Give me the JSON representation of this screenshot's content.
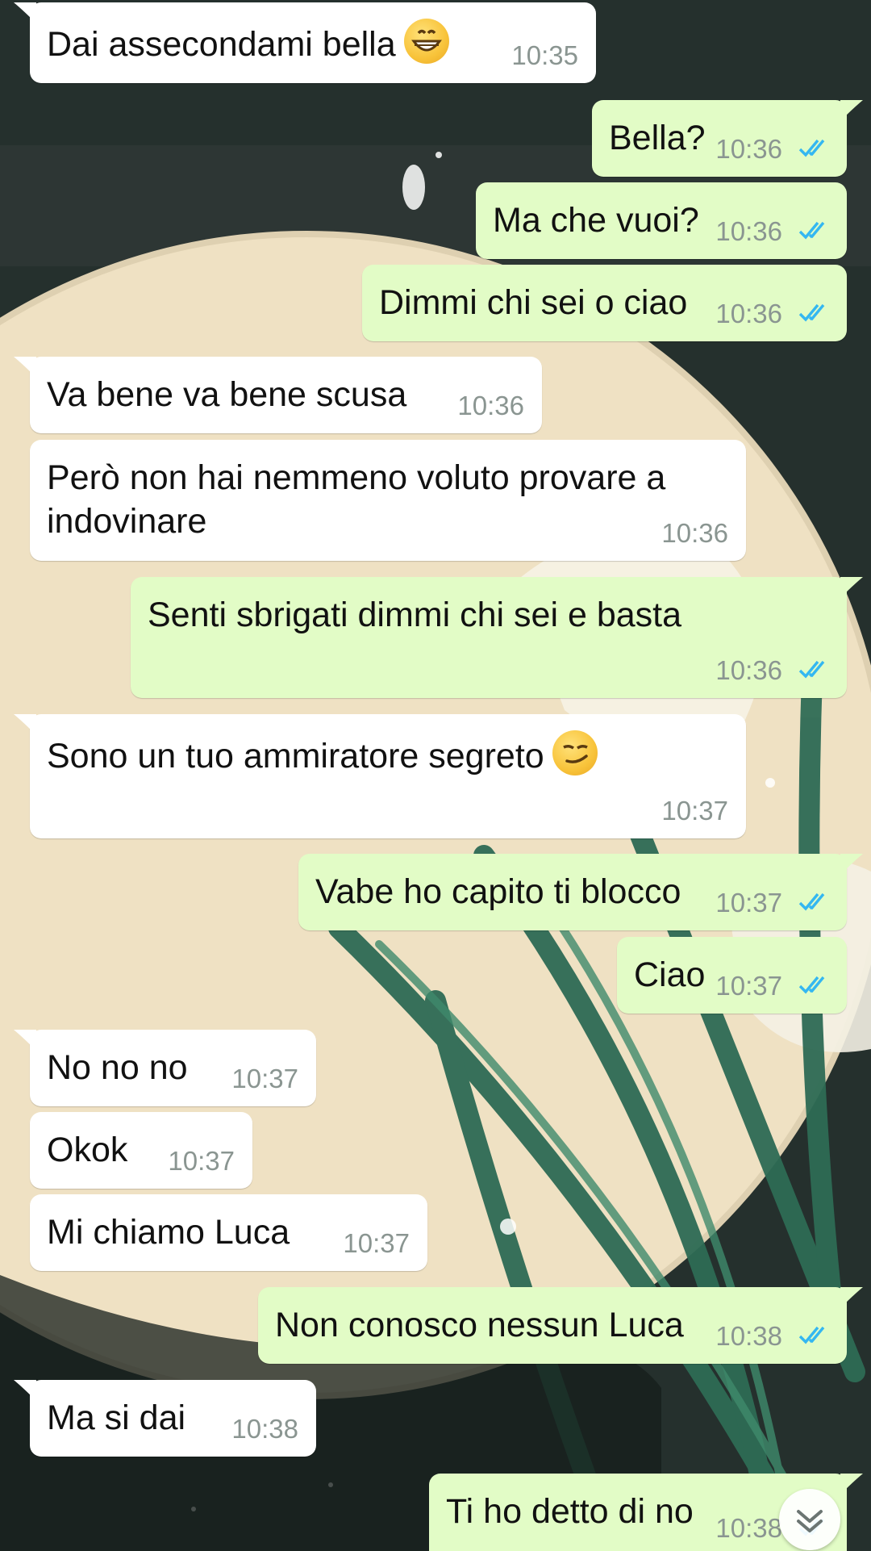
{
  "messages": [
    {
      "text": "Dai assecondami bella",
      "time": "10:35",
      "dir": "in",
      "emoji": "grinning-face"
    },
    {
      "text": "Bella?",
      "time": "10:36",
      "dir": "out",
      "status": "read"
    },
    {
      "text": "Ma che vuoi?",
      "time": "10:36",
      "dir": "out",
      "status": "read"
    },
    {
      "text": "Dimmi chi sei o ciao",
      "time": "10:36",
      "dir": "out",
      "status": "read"
    },
    {
      "text": "Va bene va bene scusa",
      "time": "10:36",
      "dir": "in"
    },
    {
      "text": "Però non hai nemmeno voluto provare a indovinare",
      "time": "10:36",
      "dir": "in"
    },
    {
      "text": "Senti sbrigati dimmi chi sei e basta",
      "time": "10:36",
      "dir": "out",
      "status": "read"
    },
    {
      "text": "Sono un tuo ammiratore segreto",
      "time": "10:37",
      "dir": "in",
      "emoji": "smirking-face"
    },
    {
      "text": "Vabe ho capito ti blocco",
      "time": "10:37",
      "dir": "out",
      "status": "read"
    },
    {
      "text": "Ciao",
      "time": "10:37",
      "dir": "out",
      "status": "read"
    },
    {
      "text": "No no no",
      "time": "10:37",
      "dir": "in"
    },
    {
      "text": "Okok",
      "time": "10:37",
      "dir": "in"
    },
    {
      "text": "Mi chiamo Luca",
      "time": "10:37",
      "dir": "in"
    },
    {
      "text": "Non conosco nessun Luca",
      "time": "10:38",
      "dir": "out",
      "status": "read"
    },
    {
      "text": "Ma si dai",
      "time": "10:38",
      "dir": "in"
    },
    {
      "text": "Ti ho detto di no",
      "time": "10:38",
      "dir": "out",
      "status": "read"
    }
  ],
  "scroll_down_icon": "chevron-double-down-icon",
  "colors": {
    "incoming_bubble": "#ffffff",
    "outgoing_bubble": "#e2fcc6",
    "read_ticks": "#34b7f1",
    "timestamp": "#8a9591"
  }
}
